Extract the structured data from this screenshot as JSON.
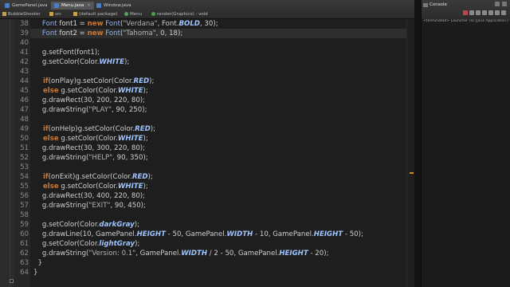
{
  "tabs": {
    "row1": [
      {
        "label": "GamePanel.java",
        "icon": "java-file-icon"
      },
      {
        "label": "Menu.java",
        "icon": "java-file-icon"
      },
      {
        "label": "Window.java",
        "icon": "java-file-icon"
      }
    ],
    "row2": [
      {
        "label": "BubbleShooter",
        "icon": "project-icon"
      },
      {
        "label": "src",
        "icon": "folder-icon"
      },
      {
        "label": "(default package)",
        "icon": "package-icon"
      },
      {
        "label": "Menu",
        "icon": "class-icon"
      },
      {
        "label": "render(Graphics) : void",
        "icon": "method-icon"
      }
    ],
    "close_glyph": "✕"
  },
  "editor": {
    "lines": [
      {
        "num": "38",
        "tokens": [
          [
            "t",
            "    Font "
          ],
          [
            "f",
            "font1"
          ],
          [
            "p",
            " = "
          ],
          [
            "k",
            "new"
          ],
          [
            "t",
            " Font"
          ],
          [
            "p",
            "("
          ],
          [
            "s",
            "\"Verdana\""
          ],
          [
            "p",
            ", Font."
          ],
          [
            "it",
            "BOLD"
          ],
          [
            "p",
            ", 30);"
          ]
        ]
      },
      {
        "num": "39",
        "tokens": [
          [
            "t",
            "    Font "
          ],
          [
            "f",
            "font2"
          ],
          [
            "p",
            " = "
          ],
          [
            "k",
            "new"
          ],
          [
            "t",
            " Font"
          ],
          [
            "p",
            "("
          ],
          [
            "s",
            "\"Tahoma\""
          ],
          [
            "p",
            ", 0, 18);"
          ]
        ]
      },
      {
        "num": "40",
        "tokens": []
      },
      {
        "num": "41",
        "tokens": [
          [
            "p",
            "    g.setFont(font1);"
          ]
        ]
      },
      {
        "num": "42",
        "tokens": [
          [
            "p",
            "    g.setColor(Color."
          ],
          [
            "it",
            "WHITE"
          ],
          [
            "p",
            ");"
          ]
        ]
      },
      {
        "num": "43",
        "tokens": []
      },
      {
        "num": "44",
        "tokens": [
          [
            "k",
            "    if"
          ],
          [
            "p",
            "(onPlay)g.setColor(Color."
          ],
          [
            "it",
            "RED"
          ],
          [
            "p",
            ");"
          ]
        ]
      },
      {
        "num": "45",
        "tokens": [
          [
            "k",
            "    else"
          ],
          [
            "p",
            " g.setColor(Color."
          ],
          [
            "it",
            "WHITE"
          ],
          [
            "p",
            ");"
          ]
        ]
      },
      {
        "num": "46",
        "tokens": [
          [
            "p",
            "    g.drawRect(30, 200, 220, 80);"
          ]
        ]
      },
      {
        "num": "47",
        "tokens": [
          [
            "p",
            "    g.drawString("
          ],
          [
            "s",
            "\"PLAY\""
          ],
          [
            "p",
            ", 90, 250);"
          ]
        ]
      },
      {
        "num": "48",
        "tokens": []
      },
      {
        "num": "49",
        "tokens": [
          [
            "k",
            "    if"
          ],
          [
            "p",
            "(onHelp)g.setColor(Color."
          ],
          [
            "it",
            "RED"
          ],
          [
            "p",
            ");"
          ]
        ]
      },
      {
        "num": "50",
        "tokens": [
          [
            "k",
            "    else"
          ],
          [
            "p",
            " g.setColor(Color."
          ],
          [
            "it",
            "WHITE"
          ],
          [
            "p",
            ");"
          ]
        ]
      },
      {
        "num": "51",
        "tokens": [
          [
            "p",
            "    g.drawRect(30, 300, 220, 80);"
          ]
        ]
      },
      {
        "num": "52",
        "tokens": [
          [
            "p",
            "    g.drawString("
          ],
          [
            "s",
            "\"HELP\""
          ],
          [
            "p",
            ", 90, 350);"
          ]
        ]
      },
      {
        "num": "53",
        "tokens": []
      },
      {
        "num": "54",
        "tokens": [
          [
            "k",
            "    if"
          ],
          [
            "p",
            "(onExit)g.setColor(Color."
          ],
          [
            "it",
            "RED"
          ],
          [
            "p",
            ");"
          ]
        ]
      },
      {
        "num": "55",
        "tokens": [
          [
            "k",
            "    else"
          ],
          [
            "p",
            " g.setColor(Color."
          ],
          [
            "it",
            "WHITE"
          ],
          [
            "p",
            ");"
          ]
        ]
      },
      {
        "num": "56",
        "tokens": [
          [
            "p",
            "    g.drawRect(30, 400, 220, 80);"
          ]
        ]
      },
      {
        "num": "57",
        "tokens": [
          [
            "p",
            "    g.drawString("
          ],
          [
            "s",
            "\"EXIT\""
          ],
          [
            "p",
            ", 90, 450);"
          ]
        ]
      },
      {
        "num": "58",
        "tokens": []
      },
      {
        "num": "59",
        "tokens": [
          [
            "p",
            "    g.setColor(Color."
          ],
          [
            "it",
            "darkGray"
          ],
          [
            "p",
            ");"
          ]
        ]
      },
      {
        "num": "60",
        "tokens": [
          [
            "p",
            "    g.drawLine(10, GamePanel."
          ],
          [
            "it",
            "HEIGHT"
          ],
          [
            "p",
            " - 50, GamePanel."
          ],
          [
            "it",
            "WIDTH"
          ],
          [
            "p",
            " - 10, GamePanel."
          ],
          [
            "it",
            "HEIGHT"
          ],
          [
            "p",
            " - 50);"
          ]
        ]
      },
      {
        "num": "61",
        "tokens": [
          [
            "p",
            "    g.setColor(Color."
          ],
          [
            "it",
            "lightGray"
          ],
          [
            "p",
            ");"
          ]
        ]
      },
      {
        "num": "62",
        "tokens": [
          [
            "p",
            "    g.drawString("
          ],
          [
            "s",
            "\"Version: 0.1\""
          ],
          [
            "p",
            ", GamePanel."
          ],
          [
            "it",
            "WIDTH"
          ],
          [
            "p",
            " / 2 - 50, GamePanel."
          ],
          [
            "it",
            "HEIGHT"
          ],
          [
            "p",
            " - 20);"
          ]
        ]
      },
      {
        "num": "63",
        "tokens": [
          [
            "p",
            "  }"
          ]
        ]
      },
      {
        "num": "64",
        "tokens": [
          [
            "p",
            "}"
          ]
        ]
      }
    ]
  },
  "console": {
    "title": "Console",
    "status": "<terminated> Launcher (4) [Java Application] C:\\"
  },
  "colors": {
    "keyword": "#cc7832",
    "constant": "#9ec3ff",
    "text": "#cfcfcf",
    "background": "#1e1e1e"
  }
}
